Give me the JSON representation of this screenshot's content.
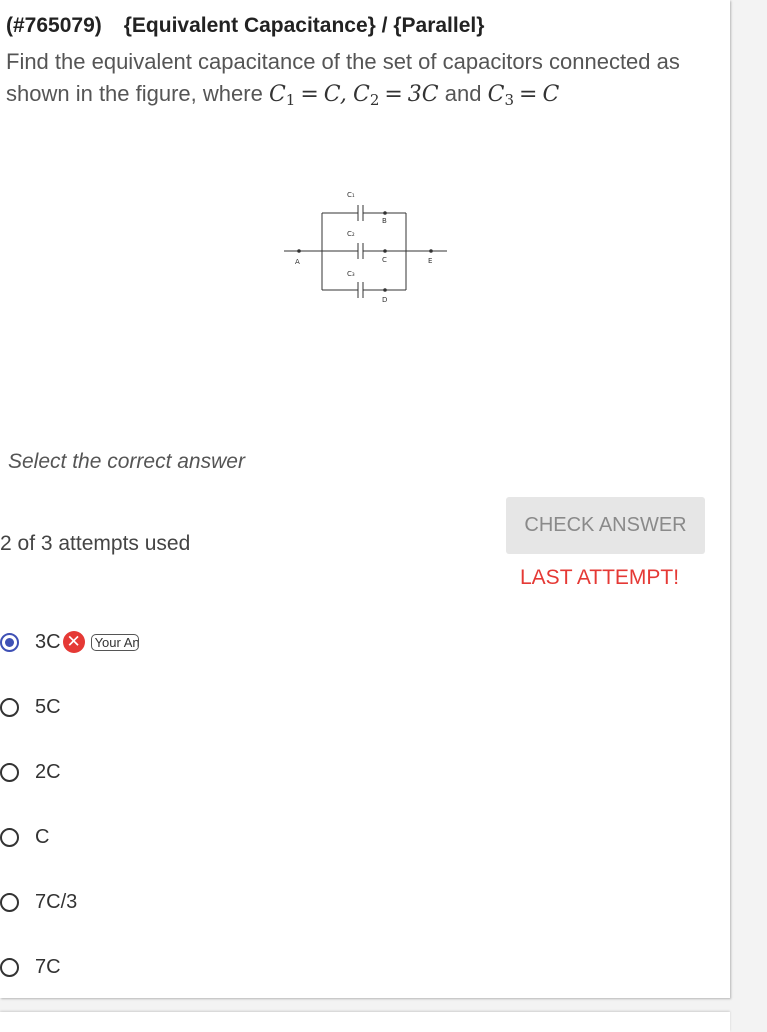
{
  "header": {
    "id": "(#765079)",
    "topic": "{Equivalent Capacitance} / {Parallel}"
  },
  "question": {
    "text": "Find the equivalent capacitance of the set of capacitors connected as shown in the figure, where",
    "c1": "C",
    "c2": "3C",
    "and": "and",
    "c3": "C"
  },
  "figure": {
    "labels": {
      "c1": "C₁",
      "c2": "C₂",
      "c3": "C₃",
      "a": "A",
      "b": "B",
      "c": "C",
      "d": "D",
      "e": "E"
    }
  },
  "instruction": "Select the correct answer",
  "attempts_text": "2 of 3 attempts used",
  "check_button": "CHECK ANSWER",
  "last_attempt": "LAST ATTEMPT!",
  "options": [
    {
      "label": "3C",
      "selected": true,
      "wrong": true
    },
    {
      "label": "5C"
    },
    {
      "label": "2C"
    },
    {
      "label": "C"
    },
    {
      "label": "7C/3"
    },
    {
      "label": "7C"
    }
  ],
  "your_answer_label": "Your Answer",
  "colors": {
    "accent": "#3f51b5",
    "error": "#e53935",
    "button_bg": "#e6e6e6"
  },
  "icons": {
    "wrong": "close-circle-icon",
    "radio": "radio-icon"
  }
}
